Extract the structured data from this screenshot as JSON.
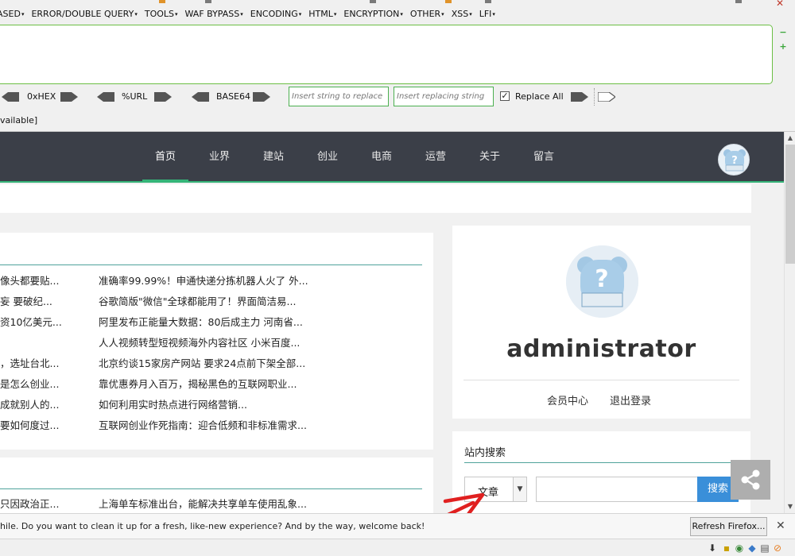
{
  "hackbar": {
    "menu": [
      "ASED",
      "ERROR/DOUBLE QUERY",
      "TOOLS",
      "WAF BYPASS",
      "ENCODING",
      "HTML",
      "ENCRYPTION",
      "OTHER",
      "XSS",
      "LFI"
    ],
    "side_minus": "−",
    "side_plus": "+",
    "hex_label": "0xHEX",
    "url_label": "%URL",
    "base64_label": "BASE64",
    "replace_placeholder": "Insert string to replace",
    "replacing_placeholder": "Insert replacing string",
    "replace_all_label": "Replace All",
    "replace_all_checked": "✓",
    "status_fragment": "vailable]"
  },
  "nav": {
    "items": [
      "首页",
      "业界",
      "建站",
      "创业",
      "电商",
      "运营",
      "关于",
      "留言"
    ],
    "active": "首页"
  },
  "news": {
    "left_col": [
      "像头都要贴...",
      "妄 要破纪...",
      "资10亿美元...",
      "",
      "，选址台北...",
      "是怎么创业...",
      "成就别人的...",
      "要如何度过..."
    ],
    "right_col": [
      "准确率99.99%！申通快递分拣机器人火了 外...",
      "谷歌简版\"微信\"全球都能用了！界面简洁易...",
      "阿里发布正能量大数据：80后成主力 河南省...",
      "人人视频转型短视频海外内容社区 小米百度...",
      "北京约谈15家房产网站 要求24点前下架全部...",
      "靠优惠券月入百万，揭秘黑色的互联网职业...",
      "如何利用实时热点进行网络营销...",
      "互联网创业作死指南：迎合低频和非标准需求..."
    ],
    "left_col2": [
      "只因政治正..."
    ],
    "right_col2": [
      "上海单车标准出台，能解决共享单车使用乱象..."
    ]
  },
  "user": {
    "name": "administrator",
    "member_center": "会员中心",
    "logout": "退出登录"
  },
  "search": {
    "title": "站内搜索",
    "type_value": "文章",
    "button": "搜索",
    "query": ""
  },
  "notification": {
    "text": "hile. Do you want to clean it up for a fresh, like-new experience? And by the way, welcome back!",
    "button": "Refresh Firefox..."
  },
  "colors": {
    "nav_bg": "#3b3f48",
    "accent_green": "#35b478",
    "search_blue": "#3a8fd9",
    "annotation_red": "#e02020"
  }
}
